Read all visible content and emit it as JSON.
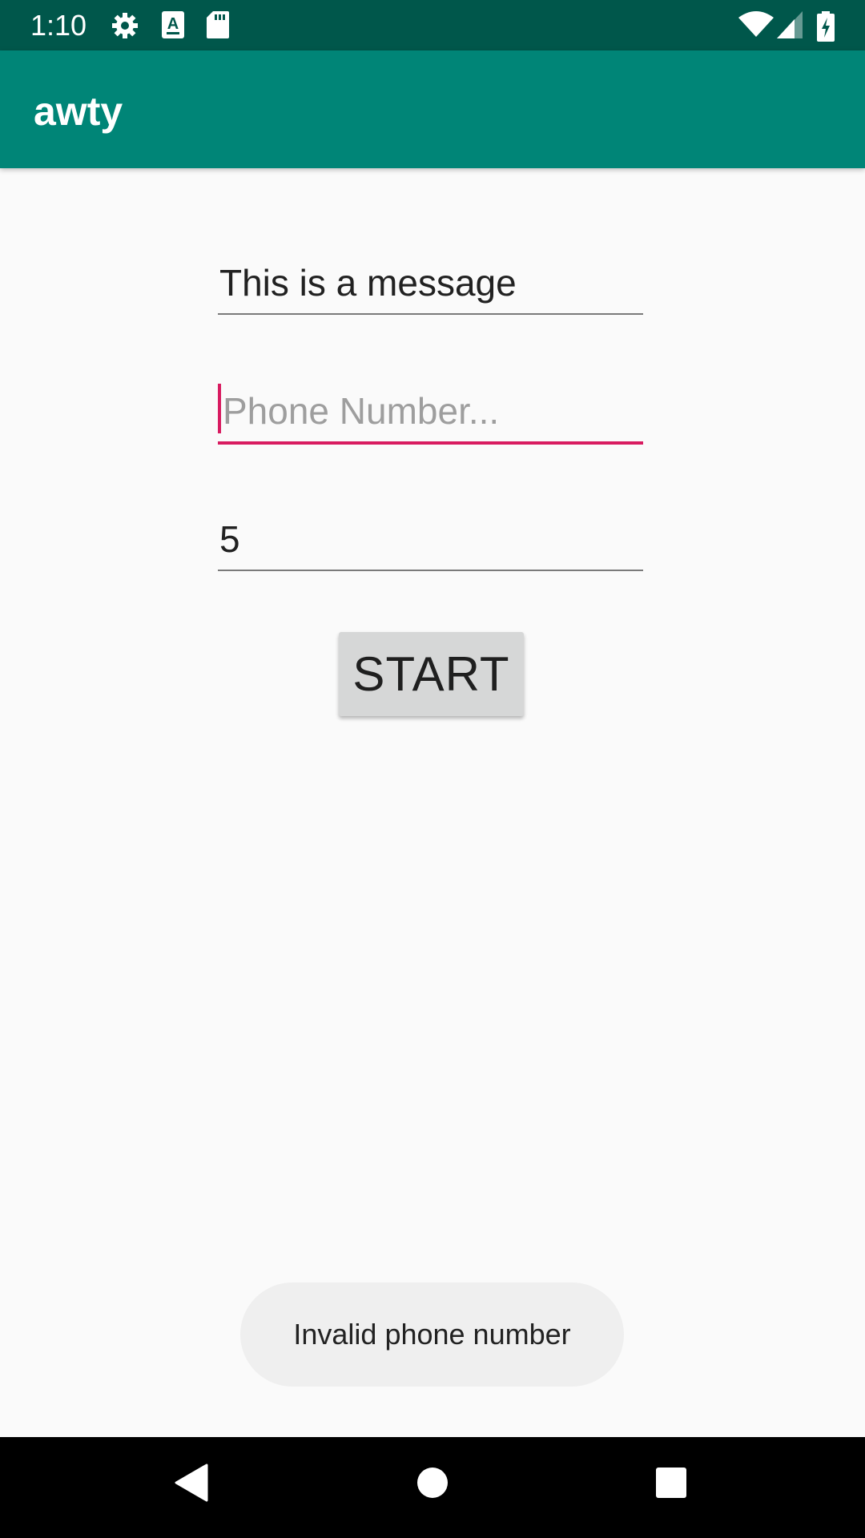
{
  "status_bar": {
    "time": "1:10",
    "left_icons": [
      "gear-icon",
      "a-keyboard-icon",
      "sd-card-icon"
    ],
    "right_icons": [
      "wifi-icon",
      "cell-signal-icon",
      "battery-charging-icon"
    ]
  },
  "app_bar": {
    "title": "awty"
  },
  "form": {
    "message_value": "This is a message",
    "phone_placeholder": "Phone Number...",
    "phone_value": "",
    "interval_value": "5",
    "start_label": "START"
  },
  "toast": {
    "text": "Invalid phone number"
  },
  "nav_bar": {
    "icons": [
      "back-icon",
      "home-icon",
      "recents-icon"
    ]
  },
  "colors": {
    "status_bar": "#00574b",
    "app_bar": "#008577",
    "accent": "#d81b60",
    "background": "#fafafa"
  }
}
